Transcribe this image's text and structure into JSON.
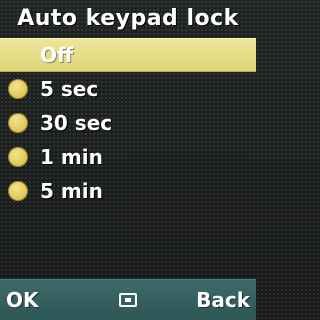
{
  "header": {
    "title": "Auto keypad lock"
  },
  "options": [
    {
      "label": "Off",
      "selected": true
    },
    {
      "label": "5 sec",
      "selected": false
    },
    {
      "label": "30 sec",
      "selected": false
    },
    {
      "label": "1 min",
      "selected": false
    },
    {
      "label": "5 min",
      "selected": false
    }
  ],
  "softkeys": {
    "left_label": "OK",
    "center_icon": "select-square-icon",
    "right_label": "Back"
  },
  "colors": {
    "highlight": "#e6df8a",
    "bullet": "#e2c957",
    "softkey_bar": "#356060"
  }
}
